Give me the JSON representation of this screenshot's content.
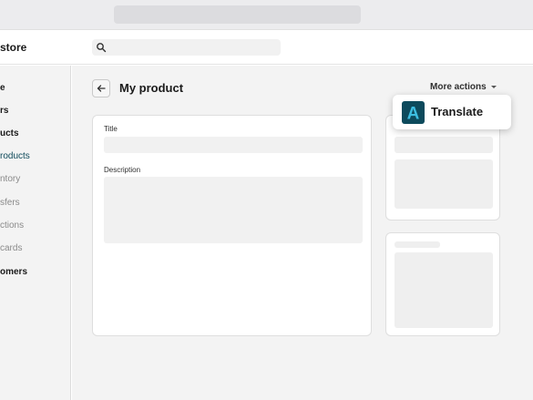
{
  "store": {
    "name": "store"
  },
  "sidebar": {
    "items": [
      {
        "label": "e"
      },
      {
        "label": "rs"
      },
      {
        "label": "ucts"
      },
      {
        "label": "roducts"
      },
      {
        "label": "ntory"
      },
      {
        "label": "sfers"
      },
      {
        "label": "ctions"
      },
      {
        "label": "cards"
      },
      {
        "label": "omers"
      }
    ]
  },
  "header": {
    "title": "My product",
    "more_actions": "More actions"
  },
  "form": {
    "title_label": "Title",
    "description_label": "Description"
  },
  "popover": {
    "app_label": "Translate",
    "logo_letter": "A"
  },
  "colors": {
    "active_nav": "#0e4a5a",
    "logo_bg": "#0d4a5c",
    "logo_fg": "#3dbde0"
  }
}
